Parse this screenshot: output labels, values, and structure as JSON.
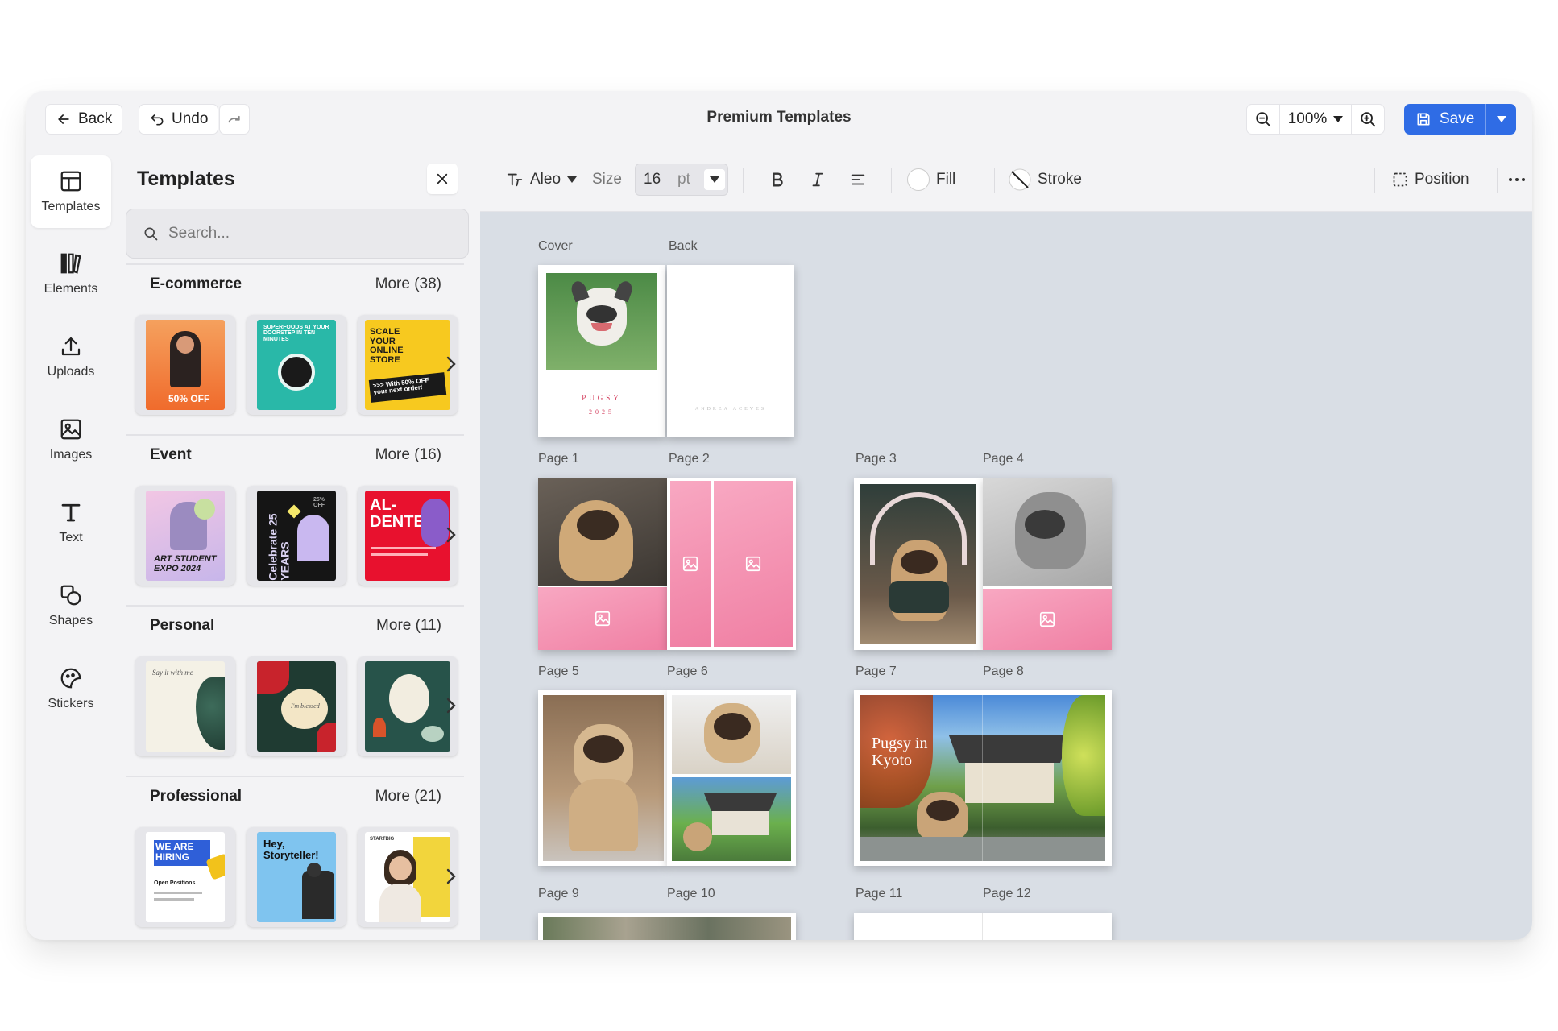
{
  "header": {
    "back_label": "Back",
    "undo_label": "Undo",
    "title": "Premium Templates",
    "zoom_value": "100%",
    "save_label": "Save"
  },
  "rail": {
    "items": [
      {
        "label": "Templates",
        "icon": "layout-icon"
      },
      {
        "label": "Elements",
        "icon": "elements-icon"
      },
      {
        "label": "Uploads",
        "icon": "upload-icon"
      },
      {
        "label": "Images",
        "icon": "image-icon"
      },
      {
        "label": "Text",
        "icon": "text-icon"
      },
      {
        "label": "Shapes",
        "icon": "shapes-icon"
      },
      {
        "label": "Stickers",
        "icon": "sticker-icon"
      }
    ]
  },
  "panel": {
    "title": "Templates",
    "search_placeholder": "Search...",
    "sections": [
      {
        "name": "E-commerce",
        "more": "More (38)",
        "thumbs": [
          {
            "text": "50% OFF"
          },
          {
            "text": "SUPERFOODS AT YOUR DOORSTEP IN TEN MINUTES"
          },
          {
            "text": "SCALE YOUR ONLINE STORE",
            "subtext": ">>> With 50% OFF your next order!"
          }
        ]
      },
      {
        "name": "Event",
        "more": "More (16)",
        "thumbs": [
          {
            "text": "ART STUDENT EXPO 2024"
          },
          {
            "text": "Celebrate 25 YEARS",
            "subtext": "25% OFF"
          },
          {
            "text": "AL-DENTE"
          }
        ]
      },
      {
        "name": "Personal",
        "more": "More (11)",
        "thumbs": [
          {
            "text": "Say it with me"
          },
          {
            "text": "I'm blessed"
          },
          {
            "text": ""
          }
        ]
      },
      {
        "name": "Professional",
        "more": "More (21)",
        "thumbs": [
          {
            "text": "WE ARE HIRING",
            "subtext": "Open Positions"
          },
          {
            "text": "Hey, Storyteller!"
          },
          {
            "text": "STARTBIG"
          }
        ]
      }
    ]
  },
  "toolbar": {
    "font_name": "Aleo",
    "size_label": "Size",
    "size_value": "16",
    "size_unit": "pt",
    "fill_label": "Fill",
    "stroke_label": "Stroke",
    "position_label": "Position"
  },
  "canvas": {
    "labels": {
      "cover": "Cover",
      "back": "Back",
      "p1": "Page 1",
      "p2": "Page 2",
      "p3": "Page 3",
      "p4": "Page 4",
      "p5": "Page 5",
      "p6": "Page 6",
      "p7": "Page 7",
      "p8": "Page 8",
      "p9": "Page 9",
      "p10": "Page 10",
      "p11": "Page 11",
      "p12": "Page 12"
    },
    "cover_title": "PUGSY",
    "cover_year": "2025",
    "back_text": "ANDREA ACEVES",
    "spread_title": "Pugsy in Kyoto"
  },
  "colors": {
    "accent": "#2f6ce5",
    "pink": "#f07fa3",
    "canvas_bg": "#d9dee5"
  }
}
